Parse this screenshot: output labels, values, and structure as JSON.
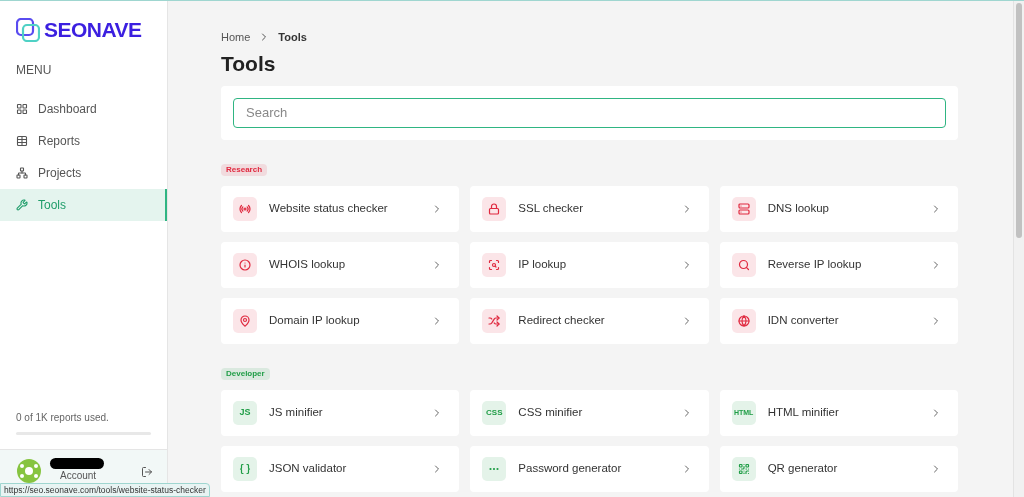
{
  "brand": {
    "name": "SEONAVE"
  },
  "sidebar": {
    "heading": "MENU",
    "items": [
      {
        "label": "Dashboard",
        "selected": false
      },
      {
        "label": "Reports",
        "selected": false
      },
      {
        "label": "Projects",
        "selected": false
      },
      {
        "label": "Tools",
        "selected": true
      }
    ],
    "usage": {
      "text": "0 of 1K reports used."
    },
    "account": {
      "label": "Account"
    }
  },
  "breadcrumb": [
    "Home",
    "Tools"
  ],
  "page_title": "Tools",
  "search": {
    "placeholder": "Search"
  },
  "categories": [
    {
      "label": "Research",
      "color": "#e0293f",
      "tools": [
        {
          "label": "Website status checker"
        },
        {
          "label": "SSL checker"
        },
        {
          "label": "DNS lookup"
        },
        {
          "label": "WHOIS lookup"
        },
        {
          "label": "IP lookup"
        },
        {
          "label": "Reverse IP lookup"
        },
        {
          "label": "Domain IP lookup"
        },
        {
          "label": "Redirect checker"
        },
        {
          "label": "IDN converter"
        }
      ]
    },
    {
      "label": "Developer",
      "color": "#1f9d46",
      "tools": [
        {
          "label": "JS minifier",
          "icon_text": "JS"
        },
        {
          "label": "CSS minifier",
          "icon_text": "CSS"
        },
        {
          "label": "HTML minifier",
          "icon_text": "HTML"
        },
        {
          "label": "JSON validator"
        },
        {
          "label": "Password generator"
        },
        {
          "label": "QR generator"
        }
      ]
    }
  ],
  "status_url": "https://seo.seonave.com/tools/website-status-checker"
}
